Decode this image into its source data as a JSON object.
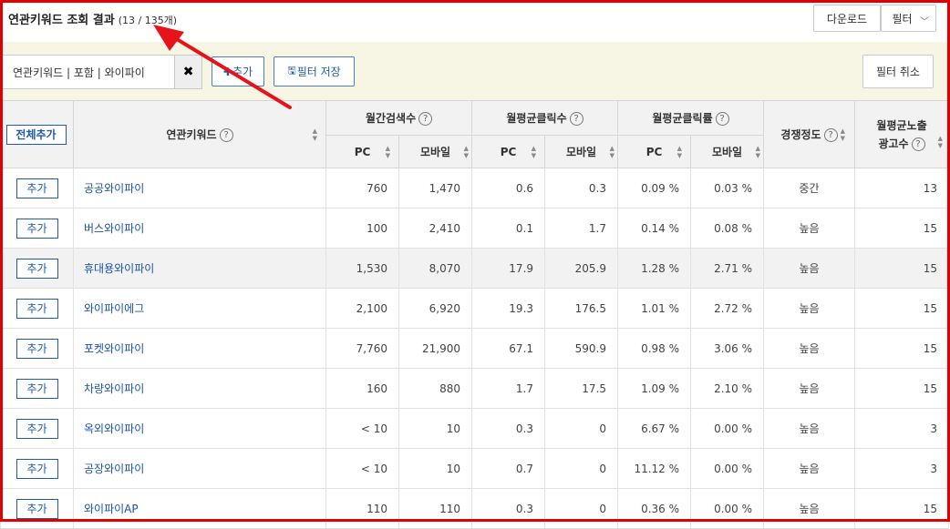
{
  "header": {
    "title": "연관키워드 조회 결과",
    "count": "(13 / 135개)",
    "download_label": "다운로드",
    "filter_label": "필터",
    "filter_chevron": "chevron-down-icon"
  },
  "filterbar": {
    "tag_text": "연관키워드 | 포함 | 와이파이",
    "tag_close": "✖",
    "add_label": "추가",
    "save_label": "필터 저장",
    "cancel_label": "필터 취소"
  },
  "table": {
    "add_all_label": "전체추가",
    "col_keyword": "연관키워드",
    "col_monthly_search": "월간검색수",
    "col_avg_clicks": "월평균클릭수",
    "col_avg_ctr": "월평균클릭률",
    "col_competition": "경쟁정도",
    "col_ads_line1": "월평균노출",
    "col_ads_line2": "광고수",
    "sub_pc": "PC",
    "sub_mobile": "모바일",
    "help_glyph": "?",
    "row_add_label": "추가",
    "rows": [
      {
        "keyword": "공공와이파이",
        "pc_search": "760",
        "mo_search": "1,470",
        "pc_clicks": "0.6",
        "mo_clicks": "0.3",
        "pc_ctr": "0.09 %",
        "mo_ctr": "0.03 %",
        "competition": "중간",
        "ads": "13"
      },
      {
        "keyword": "버스와이파이",
        "pc_search": "100",
        "mo_search": "2,410",
        "pc_clicks": "0.1",
        "mo_clicks": "1.7",
        "pc_ctr": "0.14 %",
        "mo_ctr": "0.08 %",
        "competition": "높음",
        "ads": "15"
      },
      {
        "keyword": "휴대용와이파이",
        "pc_search": "1,530",
        "mo_search": "8,070",
        "pc_clicks": "17.9",
        "mo_clicks": "205.9",
        "pc_ctr": "1.28 %",
        "mo_ctr": "2.71 %",
        "competition": "높음",
        "ads": "15"
      },
      {
        "keyword": "와이파이에그",
        "pc_search": "2,100",
        "mo_search": "6,920",
        "pc_clicks": "19.3",
        "mo_clicks": "176.5",
        "pc_ctr": "1.01 %",
        "mo_ctr": "2.72 %",
        "competition": "높음",
        "ads": "15"
      },
      {
        "keyword": "포켓와이파이",
        "pc_search": "7,760",
        "mo_search": "21,900",
        "pc_clicks": "67.1",
        "mo_clicks": "590.9",
        "pc_ctr": "0.98 %",
        "mo_ctr": "3.06 %",
        "competition": "높음",
        "ads": "15"
      },
      {
        "keyword": "차량와이파이",
        "pc_search": "160",
        "mo_search": "880",
        "pc_clicks": "1.7",
        "mo_clicks": "17.5",
        "pc_ctr": "1.09 %",
        "mo_ctr": "2.10 %",
        "competition": "높음",
        "ads": "15"
      },
      {
        "keyword": "옥외와이파이",
        "pc_search": "< 10",
        "mo_search": "10",
        "pc_clicks": "0.3",
        "mo_clicks": "0",
        "pc_ctr": "6.67 %",
        "mo_ctr": "0.00 %",
        "competition": "높음",
        "ads": "3"
      },
      {
        "keyword": "공장와이파이",
        "pc_search": "< 10",
        "mo_search": "10",
        "pc_clicks": "0.7",
        "mo_clicks": "0",
        "pc_ctr": "11.12 %",
        "mo_ctr": "0.00 %",
        "competition": "높음",
        "ads": "3"
      },
      {
        "keyword": "와이파이AP",
        "pc_search": "110",
        "mo_search": "110",
        "pc_clicks": "0.3",
        "mo_clicks": "0",
        "pc_ctr": "0.36 %",
        "mo_ctr": "0.00 %",
        "competition": "높음",
        "ads": "15"
      }
    ]
  },
  "colors": {
    "frame": "#e00000",
    "arrow": "#e8121a",
    "link": "#1a52a8",
    "button_border": "#225aa8",
    "filter_bg": "#f7f6e4",
    "header_bg": "#f2f2f2"
  }
}
